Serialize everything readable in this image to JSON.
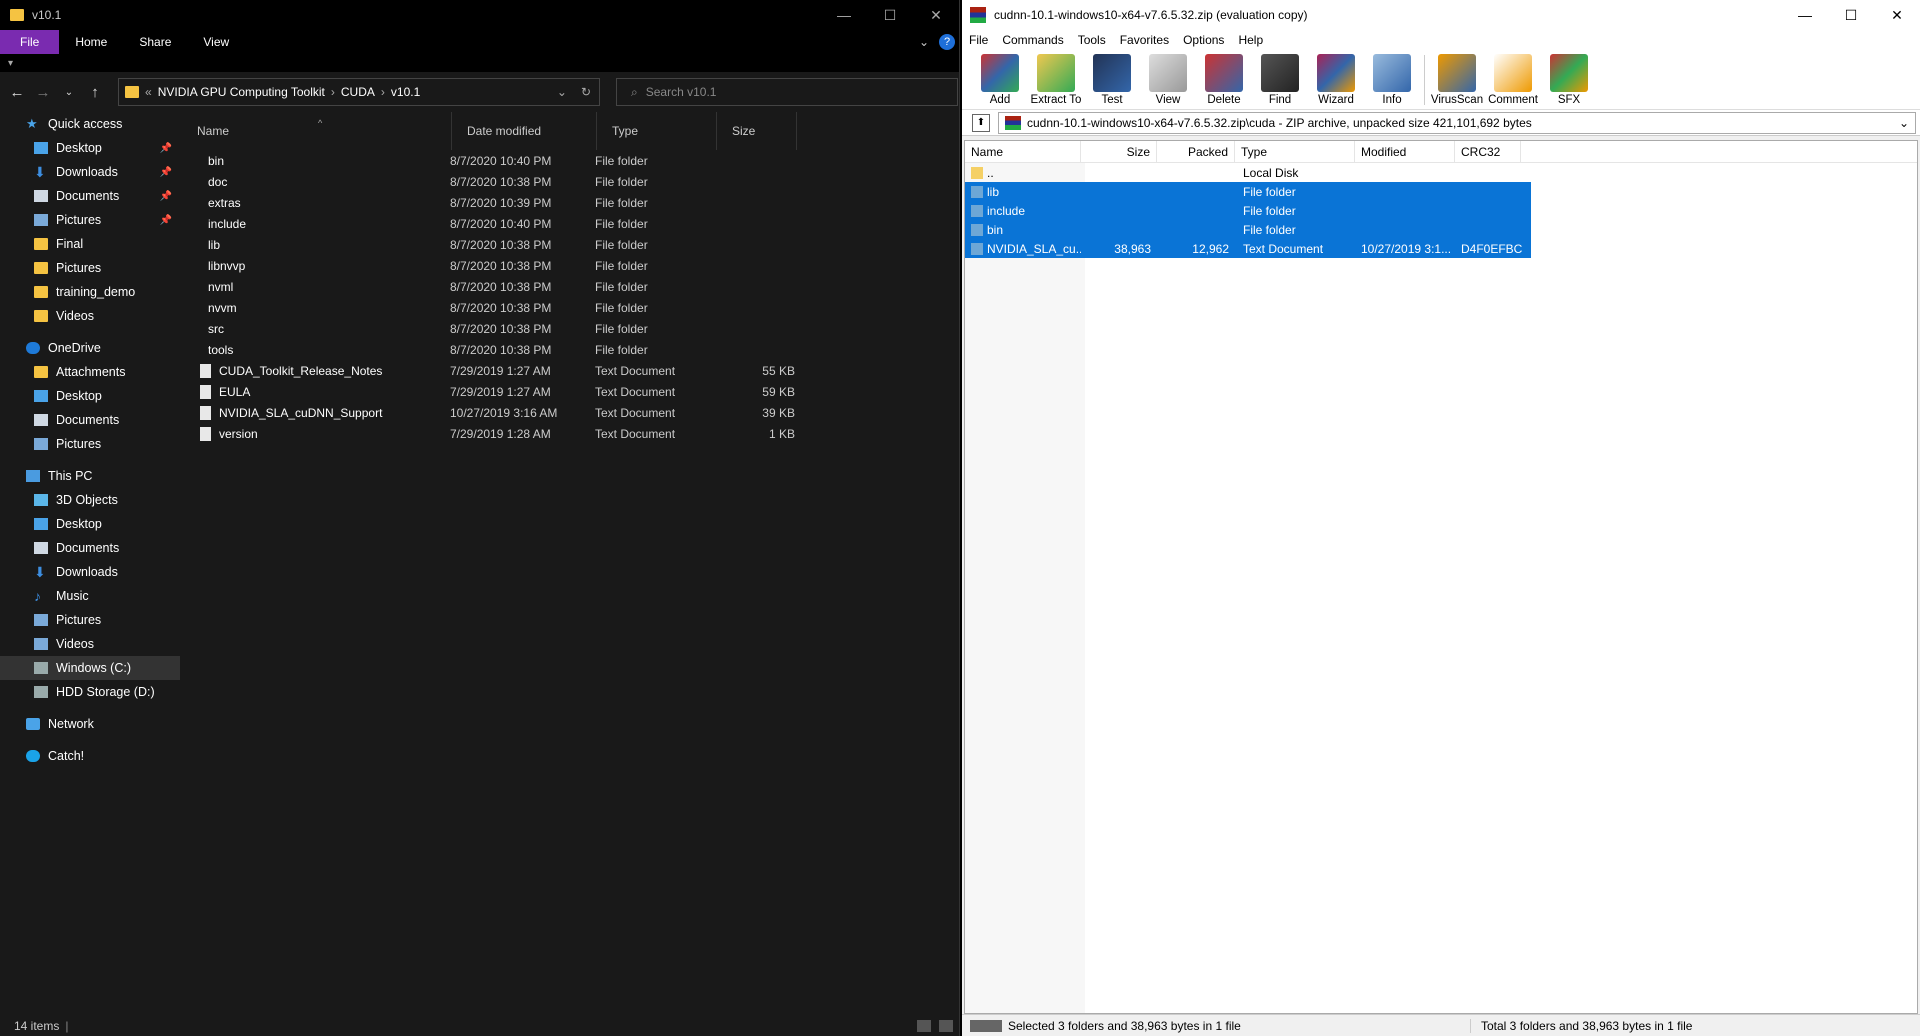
{
  "explorer": {
    "title": "v10.1",
    "ribbon_tabs": [
      "File",
      "Home",
      "Share",
      "View"
    ],
    "breadcrumb": [
      "NVIDIA GPU Computing Toolkit",
      "CUDA",
      "v10.1"
    ],
    "breadcrumb_overflow": "«",
    "search_placeholder": "Search v10.1",
    "nav": {
      "quick_access": "Quick access",
      "quick_items": [
        "Desktop",
        "Downloads",
        "Documents",
        "Pictures",
        "Final",
        "Pictures",
        "training_demo",
        "Videos"
      ],
      "onedrive": "OneDrive",
      "onedrive_items": [
        "Attachments",
        "Desktop",
        "Documents",
        "Pictures"
      ],
      "this_pc": "This PC",
      "pc_items": [
        "3D Objects",
        "Desktop",
        "Documents",
        "Downloads",
        "Music",
        "Pictures",
        "Videos",
        "Windows (C:)",
        "HDD Storage (D:)"
      ],
      "network": "Network",
      "catch": "Catch!"
    },
    "columns": {
      "name": "Name",
      "date": "Date modified",
      "type": "Type",
      "size": "Size"
    },
    "files": [
      {
        "name": "bin",
        "date": "8/7/2020 10:40 PM",
        "type": "File folder",
        "size": "",
        "kind": "folder"
      },
      {
        "name": "doc",
        "date": "8/7/2020 10:38 PM",
        "type": "File folder",
        "size": "",
        "kind": "folder"
      },
      {
        "name": "extras",
        "date": "8/7/2020 10:39 PM",
        "type": "File folder",
        "size": "",
        "kind": "folder"
      },
      {
        "name": "include",
        "date": "8/7/2020 10:40 PM",
        "type": "File folder",
        "size": "",
        "kind": "folder"
      },
      {
        "name": "lib",
        "date": "8/7/2020 10:38 PM",
        "type": "File folder",
        "size": "",
        "kind": "folder"
      },
      {
        "name": "libnvvp",
        "date": "8/7/2020 10:38 PM",
        "type": "File folder",
        "size": "",
        "kind": "folder"
      },
      {
        "name": "nvml",
        "date": "8/7/2020 10:38 PM",
        "type": "File folder",
        "size": "",
        "kind": "folder"
      },
      {
        "name": "nvvm",
        "date": "8/7/2020 10:38 PM",
        "type": "File folder",
        "size": "",
        "kind": "folder"
      },
      {
        "name": "src",
        "date": "8/7/2020 10:38 PM",
        "type": "File folder",
        "size": "",
        "kind": "folder"
      },
      {
        "name": "tools",
        "date": "8/7/2020 10:38 PM",
        "type": "File folder",
        "size": "",
        "kind": "folder"
      },
      {
        "name": "CUDA_Toolkit_Release_Notes",
        "date": "7/29/2019 1:27 AM",
        "type": "Text Document",
        "size": "55 KB",
        "kind": "text"
      },
      {
        "name": "EULA",
        "date": "7/29/2019 1:27 AM",
        "type": "Text Document",
        "size": "59 KB",
        "kind": "text"
      },
      {
        "name": "NVIDIA_SLA_cuDNN_Support",
        "date": "10/27/2019 3:16 AM",
        "type": "Text Document",
        "size": "39 KB",
        "kind": "text"
      },
      {
        "name": "version",
        "date": "7/29/2019 1:28 AM",
        "type": "Text Document",
        "size": "1 KB",
        "kind": "text"
      }
    ],
    "status": "14 items"
  },
  "winrar": {
    "title": "cudnn-10.1-windows10-x64-v7.6.5.32.zip (evaluation copy)",
    "menu": [
      "File",
      "Commands",
      "Tools",
      "Favorites",
      "Options",
      "Help"
    ],
    "toolbar": [
      "Add",
      "Extract To",
      "Test",
      "View",
      "Delete",
      "Find",
      "Wizard",
      "Info",
      "VirusScan",
      "Comment",
      "SFX"
    ],
    "path": "cudnn-10.1-windows10-x64-v7.6.5.32.zip\\cuda - ZIP archive, unpacked size 421,101,692 bytes",
    "columns": {
      "name": "Name",
      "size": "Size",
      "packed": "Packed",
      "type": "Type",
      "modified": "Modified",
      "crc": "CRC32"
    },
    "rows": [
      {
        "name": "..",
        "size": "",
        "packed": "",
        "type": "Local Disk",
        "modified": "",
        "crc": "",
        "selected": false
      },
      {
        "name": "lib",
        "size": "",
        "packed": "",
        "type": "File folder",
        "modified": "",
        "crc": "",
        "selected": true
      },
      {
        "name": "include",
        "size": "",
        "packed": "",
        "type": "File folder",
        "modified": "",
        "crc": "",
        "selected": true
      },
      {
        "name": "bin",
        "size": "",
        "packed": "",
        "type": "File folder",
        "modified": "",
        "crc": "",
        "selected": true
      },
      {
        "name": "NVIDIA_SLA_cu...",
        "size": "38,963",
        "packed": "12,962",
        "type": "Text Document",
        "modified": "10/27/2019 3:1...",
        "crc": "D4F0EFBC",
        "selected": true
      }
    ],
    "status_left": "Selected 3 folders and 38,963 bytes in 1 file",
    "status_right": "Total 3 folders and 38,963 bytes in 1 file"
  }
}
